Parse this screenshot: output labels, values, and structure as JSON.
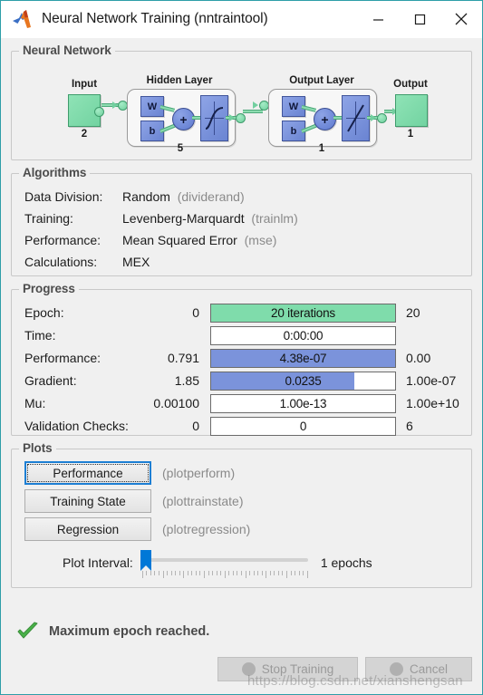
{
  "window": {
    "title": "Neural Network Training (nntraintool)",
    "app_icon": "matlab-logo-icon",
    "minimize_label": "—",
    "maximize_label": "☐",
    "close_label": "✕"
  },
  "neural_network": {
    "group_title": "Neural Network",
    "input": {
      "label": "Input",
      "count": "2"
    },
    "hidden_layer": {
      "label": "Hidden Layer",
      "count": "5",
      "w": "W",
      "b": "b",
      "sum": "+",
      "transfer": "sigmoid"
    },
    "output_layer": {
      "label": "Output Layer",
      "count": "1",
      "w": "W",
      "b": "b",
      "sum": "+",
      "transfer": "linear"
    },
    "output": {
      "label": "Output",
      "count": "1"
    }
  },
  "algorithms": {
    "group_title": "Algorithms",
    "rows": [
      {
        "label": "Data Division:",
        "value": "Random",
        "fn": "(dividerand)"
      },
      {
        "label": "Training:",
        "value": "Levenberg-Marquardt",
        "fn": "(trainlm)"
      },
      {
        "label": "Performance:",
        "value": "Mean Squared Error",
        "fn": "(mse)"
      },
      {
        "label": "Calculations:",
        "value": "MEX",
        "fn": ""
      }
    ]
  },
  "progress": {
    "group_title": "Progress",
    "rows": [
      {
        "label": "Epoch:",
        "left": "0",
        "bar_text": "20 iterations",
        "right": "20",
        "fill_pct": 100,
        "fill_color": "#7fdcab"
      },
      {
        "label": "Time:",
        "left": "",
        "bar_text": "0:00:00",
        "right": "",
        "fill_pct": 0,
        "fill_color": "#7fdcab"
      },
      {
        "label": "Performance:",
        "left": "0.791",
        "bar_text": "4.38e-07",
        "right": "0.00",
        "fill_pct": 100,
        "fill_color": "#7b93db"
      },
      {
        "label": "Gradient:",
        "left": "1.85",
        "bar_text": "0.0235",
        "right": "1.00e-07",
        "fill_pct": 78,
        "fill_color": "#7b93db"
      },
      {
        "label": "Mu:",
        "left": "0.00100",
        "bar_text": "1.00e-13",
        "right": "1.00e+10",
        "fill_pct": 0,
        "fill_color": "#7b93db"
      },
      {
        "label": "Validation Checks:",
        "left": "0",
        "bar_text": "0",
        "right": "6",
        "fill_pct": 0,
        "fill_color": "#7b93db"
      }
    ]
  },
  "plots": {
    "group_title": "Plots",
    "buttons": [
      {
        "label": "Performance",
        "fn": "(plotperform)",
        "focused": true
      },
      {
        "label": "Training State",
        "fn": "(plottrainstate)",
        "focused": false
      },
      {
        "label": "Regression",
        "fn": "(plotregression)",
        "focused": false
      }
    ],
    "interval": {
      "label": "Plot Interval:",
      "value": "1 epochs",
      "slider_position_pct": 0
    }
  },
  "status": {
    "icon": "green-check-icon",
    "message": "Maximum epoch reached.",
    "stop_button": "Stop Training",
    "cancel_button": "Cancel",
    "watermark": "https://blog.csdn.net/xianshengsan"
  },
  "colors": {
    "green_fill": "#7fdcab",
    "blue_fill": "#7b93db",
    "accent_blue": "#0078d7",
    "window_border": "#2e9ea8"
  }
}
